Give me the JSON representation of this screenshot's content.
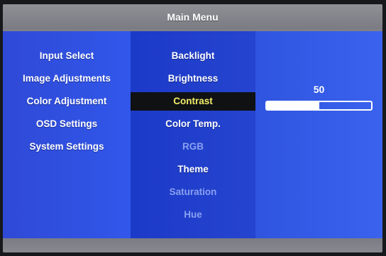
{
  "header": {
    "title": "Main Menu"
  },
  "left_menu": {
    "items": [
      {
        "label": "Input Select"
      },
      {
        "label": "Image Adjustments"
      },
      {
        "label": "Color Adjustment"
      },
      {
        "label": "OSD Settings"
      },
      {
        "label": "System Settings"
      }
    ]
  },
  "sub_menu": {
    "items": [
      {
        "label": "Backlight",
        "state": "enabled"
      },
      {
        "label": "Brightness",
        "state": "enabled"
      },
      {
        "label": "Contrast",
        "state": "selected"
      },
      {
        "label": "Color Temp.",
        "state": "enabled"
      },
      {
        "label": "RGB",
        "state": "disabled"
      },
      {
        "label": "Theme",
        "state": "enabled"
      },
      {
        "label": "Saturation",
        "state": "disabled"
      },
      {
        "label": "Hue",
        "state": "disabled"
      }
    ]
  },
  "value_panel": {
    "value": "50",
    "level_percent": 50
  },
  "colors": {
    "selected_text": "#f2ee6a",
    "selected_bg": "#0f1113",
    "panel_blue": "#2544cf"
  }
}
